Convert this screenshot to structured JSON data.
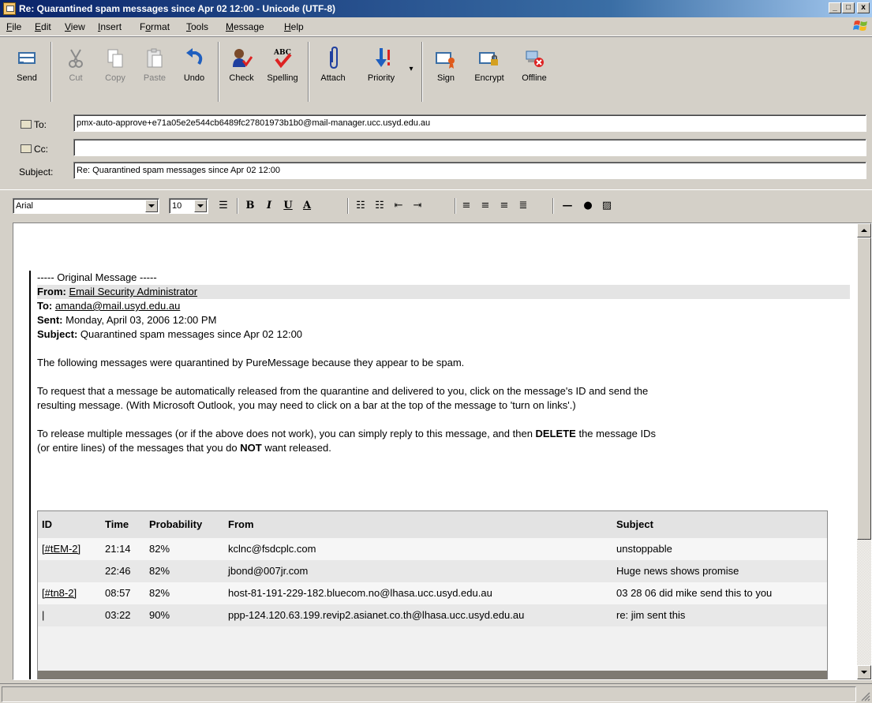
{
  "window": {
    "title": "Re: Quarantined spam messages since Apr 02 12:00 - Unicode (UTF-8)",
    "minimize": "_",
    "maximize": "□",
    "close": "x"
  },
  "menu": {
    "items": [
      {
        "u": "F",
        "rest": "ile"
      },
      {
        "u": "E",
        "rest": "dit"
      },
      {
        "u": "V",
        "rest": "iew"
      },
      {
        "u": "I",
        "rest": "nsert"
      },
      {
        "pre": "F",
        "u": "o",
        "rest": "rmat"
      },
      {
        "u": "T",
        "rest": "ools"
      },
      {
        "u": "M",
        "rest": "essage"
      },
      {
        "u": "H",
        "rest": "elp"
      }
    ]
  },
  "toolbar": {
    "send": "Send",
    "cut": "Cut",
    "copy": "Copy",
    "paste": "Paste",
    "undo": "Undo",
    "check": "Check",
    "spelling": "Spelling",
    "attach": "Attach",
    "priority": "Priority",
    "sign": "Sign",
    "encrypt": "Encrypt",
    "offline": "Offline"
  },
  "header": {
    "to_label": "To:",
    "to_value": "pmx-auto-approve+e71a05e2e544cb6489fc27801973b1b0@mail-manager.ucc.usyd.edu.au",
    "cc_label": "Cc:",
    "cc_value": "",
    "subject_label": "Subject:",
    "subject_value": "Re: Quarantined spam messages since Apr 02 12:00"
  },
  "format": {
    "font": "Arial",
    "size": "10",
    "bold": "B",
    "italic": "I",
    "underline": "U",
    "color": "A"
  },
  "message": {
    "original_header": "----- Original Message -----",
    "from_label": "From:",
    "from_value": "Email Security Administrator",
    "to_label": "To:",
    "to_value": "amanda@mail.usyd.edu.au",
    "sent_label": "Sent:",
    "sent_value": "Monday, April 03, 2006 12:00 PM",
    "subject_label": "Subject:",
    "subject_value": "Quarantined spam messages since Apr 02 12:00",
    "para1": "The following messages were quarantined by PureMessage because they appear to be spam.",
    "para2_line1": "To request that a message be automatically released from the quarantine and delivered to you, click on the message's ID and send the",
    "para2_line2": "resulting message. (With Microsoft Outlook, you may need to click on a bar at the top of the message to 'turn on links'.)",
    "para3_a": "To release multiple messages (or if the above does not work), you can simply reply to this message, and then ",
    "para3_b": "DELETE",
    "para3_c": " the message IDs",
    "para3_d": "(or entire lines) of the messages that you do ",
    "para3_e": "NOT",
    "para3_f": " want released."
  },
  "table": {
    "headers": {
      "id": "ID",
      "time": "Time",
      "probability": "Probability",
      "from": "From",
      "subject": "Subject"
    },
    "rows": [
      {
        "id": "[#tEM-2]",
        "time": "21:14",
        "probability": "82%",
        "from": "kclnc@fsdcplc.com",
        "subject": "unstoppable"
      },
      {
        "id": "",
        "time": "22:46",
        "probability": "82%",
        "from": "jbond@007jr.com",
        "subject": "Huge news shows promise"
      },
      {
        "id": "[#tn8-2]",
        "time": "08:57",
        "probability": "82%",
        "from": "host-81-191-229-182.bluecom.no@lhasa.ucc.usyd.edu.au",
        "subject": "03 28 06 did mike send this to you"
      },
      {
        "id": "|",
        "time": "03:22",
        "probability": "90%",
        "from": "ppp-124.120.63.199.revip2.asianet.co.th@lhasa.ucc.usyd.edu.au",
        "subject": "re: jim sent this"
      }
    ]
  }
}
